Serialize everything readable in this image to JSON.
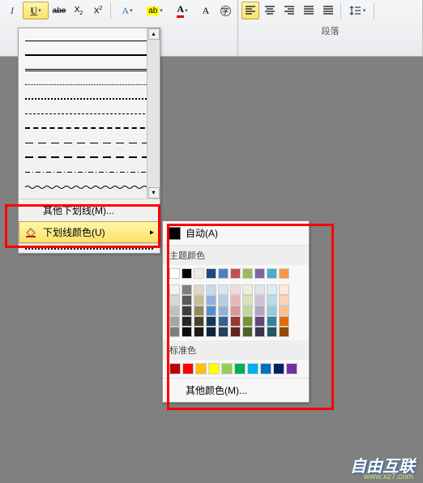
{
  "ribbon": {
    "paragraph_label": "段落"
  },
  "underline_menu": {
    "more_styles": "其他下划线(M)...",
    "color_item": "下划线颜色(U)"
  },
  "color_panel": {
    "auto": "自动(A)",
    "theme_header": "主题颜色",
    "theme_row1": [
      "#ffffff",
      "#000000",
      "#eeece1",
      "#1f497d",
      "#4f81bd",
      "#c0504d",
      "#9bbb59",
      "#8064a2",
      "#4bacc6",
      "#f79646"
    ],
    "theme_shades": [
      [
        "#f2f2f2",
        "#7f7f7f",
        "#ddd9c3",
        "#c6d9f0",
        "#dbe5f1",
        "#f2dcdb",
        "#ebf1dd",
        "#e5e0ec",
        "#dbeef3",
        "#fdeada"
      ],
      [
        "#d8d8d8",
        "#595959",
        "#c4bd97",
        "#8db3e2",
        "#b8cce4",
        "#e5b9b7",
        "#d7e3bc",
        "#ccc1d9",
        "#b7dde8",
        "#fbd5b5"
      ],
      [
        "#bfbfbf",
        "#3f3f3f",
        "#938953",
        "#548dd4",
        "#95b3d7",
        "#d99694",
        "#c3d69b",
        "#b2a2c7",
        "#92cddc",
        "#fac08f"
      ],
      [
        "#a5a5a5",
        "#262626",
        "#494429",
        "#17365d",
        "#366092",
        "#953734",
        "#76923c",
        "#5f497a",
        "#31859b",
        "#e36c09"
      ],
      [
        "#7f7f7f",
        "#0c0c0c",
        "#1d1b10",
        "#0f243e",
        "#244061",
        "#632423",
        "#4f6128",
        "#3f3151",
        "#205867",
        "#974806"
      ]
    ],
    "standard_header": "标准色",
    "standard": [
      "#c00000",
      "#ff0000",
      "#ffc000",
      "#ffff00",
      "#92d050",
      "#00b050",
      "#00b0f0",
      "#0070c0",
      "#002060",
      "#7030a0"
    ],
    "more_colors": "其他颜色(M)..."
  },
  "watermark": {
    "brand": "自由互联",
    "url": "www.xz7.com"
  }
}
